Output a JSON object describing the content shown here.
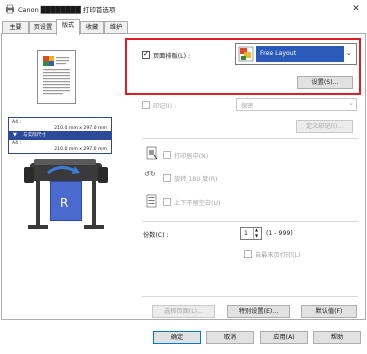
{
  "window": {
    "title": "Canon ████████ 打印首选项",
    "close_glyph": "✕"
  },
  "tabs": [
    "主要",
    "页设置",
    "版式",
    "收藏",
    "维护"
  ],
  "active_tab": 2,
  "preview": {
    "row1": "A4 :",
    "row2": "210.0 mm x 297.0 mm",
    "row3": "与实际尺寸",
    "row4": "A4 :",
    "row5": "210.0 mm x 297.0 mm"
  },
  "page_layout": {
    "checkbox_label": "页面排版(L) :",
    "checked": true,
    "select_value": "Free Layout",
    "settings_button": "设置(S)..."
  },
  "stamp": {
    "checkbox_label": "印记(I) :",
    "select_value": "保密",
    "define_button": "定义印记(I)..."
  },
  "options": {
    "center": "打印居中(N)",
    "rotate": "旋转 180 度(R)",
    "flip": "上下不留空白(U)"
  },
  "copies": {
    "label": "份数(C) :",
    "value": "1",
    "range": "(1 - 999)",
    "collate": "自最末页打印(L)"
  },
  "buttons": {
    "select_page": "选择页面(L)...",
    "special": "特别设置(E)...",
    "defaults": "默认值(F)"
  },
  "dialog_buttons": {
    "ok": "确定",
    "cancel": "取消",
    "apply": "应用(A)",
    "help": "帮助"
  },
  "colors": {
    "highlight_border": "#e02020",
    "layout_icon_bg": "#2a5bb8"
  }
}
